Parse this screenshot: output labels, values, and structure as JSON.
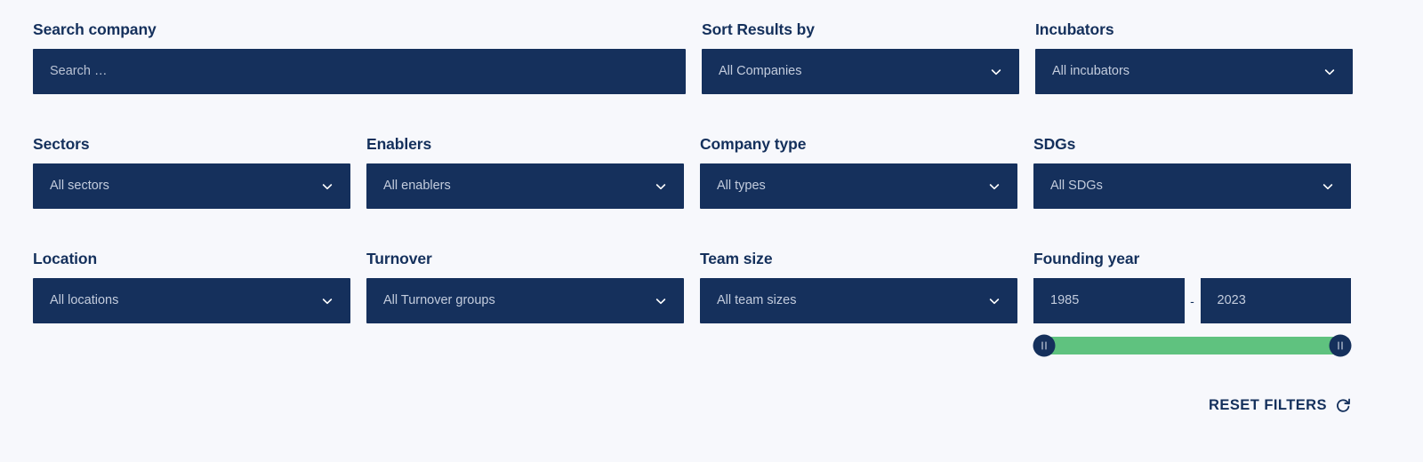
{
  "search": {
    "label": "Search company",
    "placeholder": "Search …"
  },
  "sort": {
    "label": "Sort Results by",
    "value": "All Companies"
  },
  "incubators": {
    "label": "Incubators",
    "value": "All incubators"
  },
  "sectors": {
    "label": "Sectors",
    "value": "All sectors"
  },
  "enablers": {
    "label": "Enablers",
    "value": "All enablers"
  },
  "company_type": {
    "label": "Company type",
    "value": "All types"
  },
  "sdgs": {
    "label": "SDGs",
    "value": "All SDGs"
  },
  "location": {
    "label": "Location",
    "value": "All locations"
  },
  "turnover": {
    "label": "Turnover",
    "value": "All Turnover groups"
  },
  "team_size": {
    "label": "Team size",
    "value": "All team sizes"
  },
  "founding_year": {
    "label": "Founding year",
    "from": "1985",
    "to": "2023",
    "separator": "-"
  },
  "reset": {
    "label": "RESET FILTERS"
  },
  "colors": {
    "background": "#f7f8fc",
    "field_navy": "#15305c",
    "label_navy": "#14305c",
    "slider_green": "#5fc27f",
    "placeholder": "#b9c2d4"
  }
}
